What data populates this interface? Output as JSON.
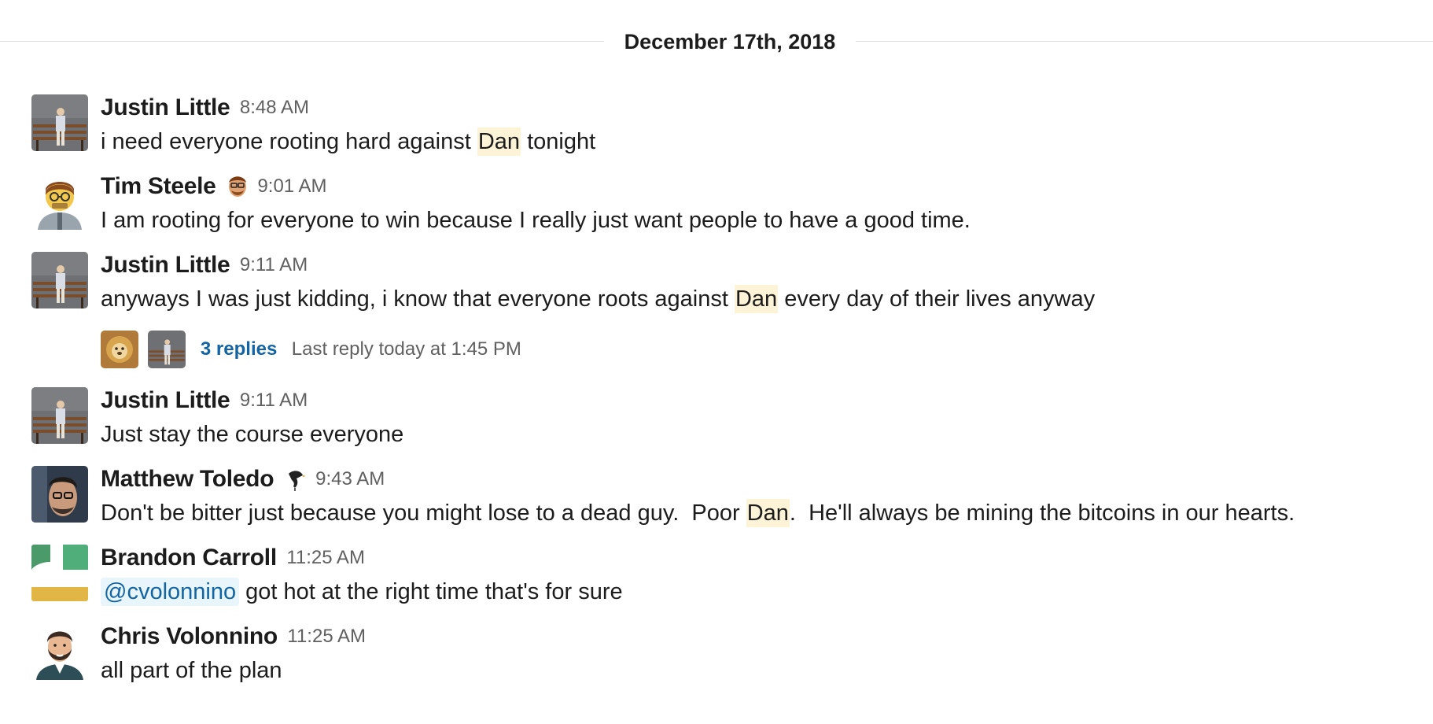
{
  "day_divider": {
    "label": "December 17th, 2018"
  },
  "messages": [
    {
      "sender": "Justin Little",
      "time": "8:48 AM",
      "text_parts": [
        "i need everyone rooting hard against ",
        "Dan",
        " tonight"
      ],
      "avatar_icon": "man-on-bench-avatar"
    },
    {
      "sender": "Tim Steele",
      "time": "9:01 AM",
      "text_parts": [
        "I am rooting for everyone to win because I really just want people to have a good time."
      ],
      "avatar_icon": "glasses-face-avatar",
      "status_icon": "bearded-face-emoji"
    },
    {
      "sender": "Justin Little",
      "time": "9:11 AM",
      "text_parts": [
        "anyways I was just kidding, i know that everyone roots against ",
        "Dan",
        " every day of their lives anyway"
      ],
      "avatar_icon": "man-on-bench-avatar",
      "thread": {
        "replies": "3 replies",
        "last_reply": "Last reply today at 1:45 PM"
      }
    },
    {
      "sender": "Justin Little",
      "time": "9:11 AM",
      "text_parts": [
        "Just stay the course everyone"
      ],
      "avatar_icon": "man-on-bench-avatar"
    },
    {
      "sender": "Matthew Toledo",
      "time": "9:43 AM",
      "text_parts": [
        "Don't be bitter just because you might lose to a dead guy.  Poor ",
        "Dan",
        ".  He'll always be mining the bitcoins in our hearts."
      ],
      "avatar_icon": "photo-avatar",
      "status_icon": "bird-emoji"
    },
    {
      "sender": "Brandon Carroll",
      "time": "11:25 AM",
      "text_parts": [
        "@cvolonnino",
        " got hot at the right time that's for sure"
      ],
      "avatar_icon": "geometric-avatar"
    },
    {
      "sender": "Chris Volonnino",
      "time": "11:25 AM",
      "text_parts": [
        "all part of the plan"
      ],
      "avatar_icon": "bearded-man-avatar"
    }
  ]
}
